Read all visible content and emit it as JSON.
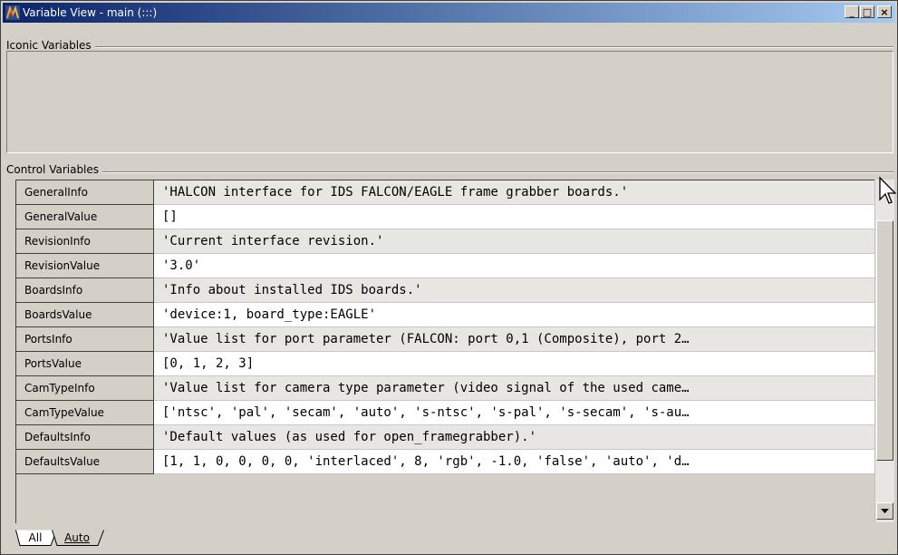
{
  "window": {
    "title": "Variable View - main (:::)",
    "minimize_glyph": "_",
    "maximize_glyph": "□",
    "close_glyph": "×"
  },
  "iconic": {
    "label": "Iconic Variables"
  },
  "control": {
    "label": "Control Variables",
    "rows": [
      {
        "name": "GeneralInfo",
        "value": "'HALCON interface for IDS FALCON/EAGLE frame grabber boards.'"
      },
      {
        "name": "GeneralValue",
        "value": "[]"
      },
      {
        "name": "RevisionInfo",
        "value": "'Current interface revision.'"
      },
      {
        "name": "RevisionValue",
        "value": "'3.0'"
      },
      {
        "name": "BoardsInfo",
        "value": "'Info about installed IDS boards.'"
      },
      {
        "name": "BoardsValue",
        "value": "'device:1, board_type:EAGLE'"
      },
      {
        "name": "PortsInfo",
        "value": "'Value list for port parameter (FALCON: port 0,1 (Composite), port 2…"
      },
      {
        "name": "PortsValue",
        "value": "[0, 1, 2, 3]"
      },
      {
        "name": "CamTypeInfo",
        "value": "'Value list for camera type parameter (video signal of the used came…"
      },
      {
        "name": "CamTypeValue",
        "value": "['ntsc', 'pal', 'secam', 'auto', 's-ntsc', 's-pal', 's-secam', 's-au…"
      },
      {
        "name": "DefaultsInfo",
        "value": "'Default values (as used for open_framegrabber).'"
      },
      {
        "name": "DefaultsValue",
        "value": "[1, 1, 0, 0, 0, 0, 'interlaced', 8, 'rgb', -1.0, 'false', 'auto', 'd…"
      }
    ]
  },
  "tabs": [
    {
      "label": "All",
      "active": true
    },
    {
      "label": "Auto",
      "active": false
    }
  ],
  "scroll": {
    "position_fraction": 0.0,
    "visible_fraction": 0.85
  }
}
